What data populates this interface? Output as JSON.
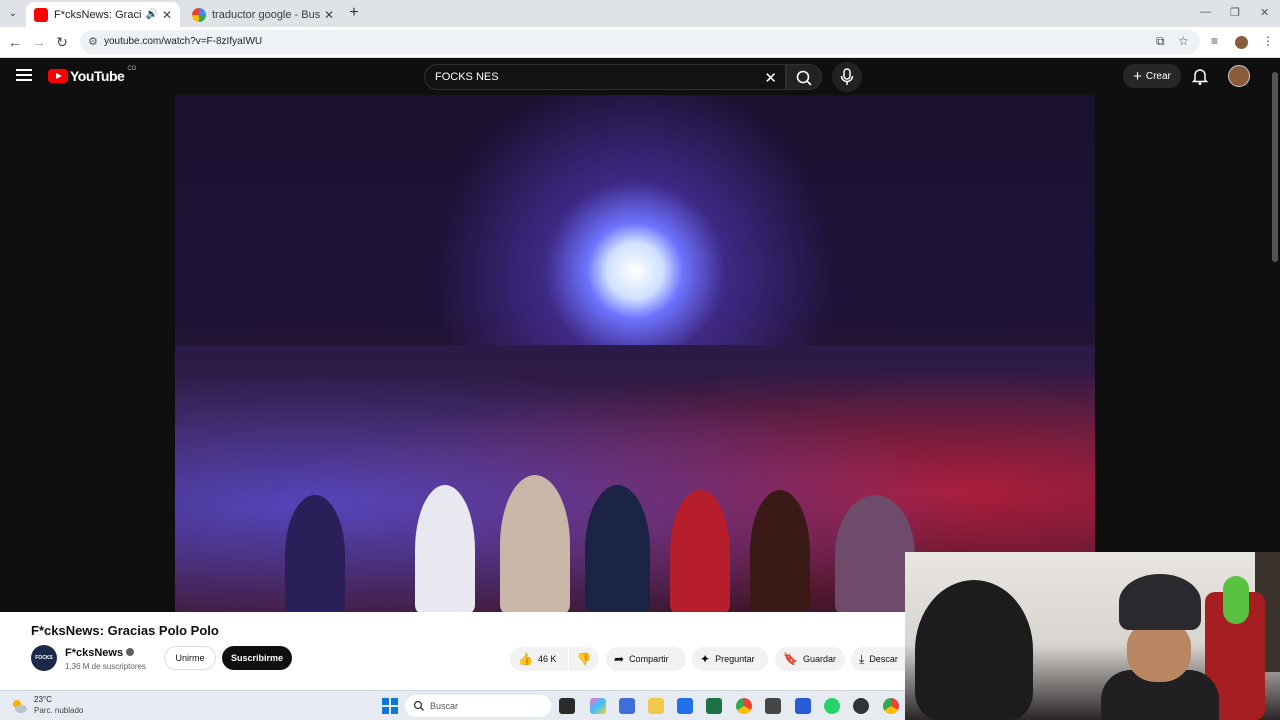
{
  "browser": {
    "tabs": [
      {
        "title": "F*cksNews: Gracias Polo Po",
        "active": true
      },
      {
        "title": "traductor google - Buscar con G",
        "active": false
      }
    ],
    "url": "youtube.com/watch?v=F-8zIfyaIWU"
  },
  "youtube": {
    "logo_text": "YouTube",
    "region": "CO",
    "search_query": "FOCKS NES",
    "create_label": "Crear"
  },
  "video": {
    "title": "F*cksNews: Gracias Polo Polo",
    "channel": {
      "name": "F*cksNews",
      "subscribers": "1,36 M de suscriptores",
      "logo_text": "FOCKS NEWS"
    },
    "buttons": {
      "join": "Unirme",
      "subscribe": "Suscribirme",
      "likes": "46 K",
      "share": "Compartir",
      "ask": "Preguntar",
      "save": "Guardar",
      "download": "Descar"
    }
  },
  "taskbar": {
    "temperature": "23°C",
    "condition": "Parc. nublado",
    "search_placeholder": "Buscar"
  },
  "colors": {
    "youtube_red": "#ff0000",
    "dark_bg": "#0f0f0f",
    "chip_bg": "#f2f2f2"
  }
}
